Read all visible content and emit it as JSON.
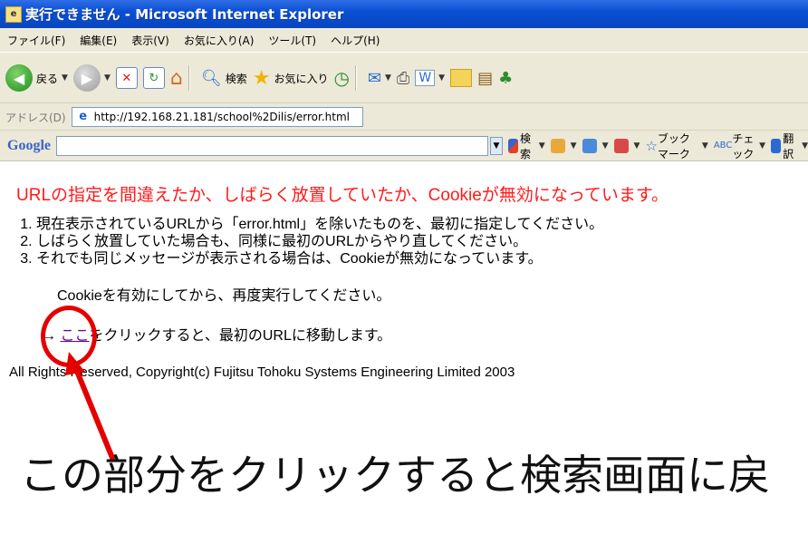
{
  "window": {
    "title": "実行できません - Microsoft Internet Explorer"
  },
  "menu": [
    "ファイル(F)",
    "編集(E)",
    "表示(V)",
    "お気に入り(A)",
    "ツール(T)",
    "ヘルプ(H)"
  ],
  "toolbar": {
    "back_label": "戻る",
    "search_label": "検索",
    "favorites_label": "お気に入り"
  },
  "address": {
    "label": "アドレス(D)",
    "url": "http://192.168.21.181/school%2Dilis/error.html"
  },
  "google": {
    "logo": "Google",
    "search_label": "検索",
    "bookmark_label": "ブックマーク",
    "check_label": "チェック",
    "translate_label": "翻訳"
  },
  "page": {
    "heading": "URLの指定を間違えたか、しばらく放置していたか、Cookieが無効になっています。",
    "items": [
      "現在表示されているURLから「error.html」を除いたものを、最初に指定してください。",
      "しばらく放置していた場合も、同様に最初のURLからやり直してください。",
      "それでも同じメッセージが表示される場合は、Cookieが無効になっています。"
    ],
    "cookie_line": "Cookieを有効にしてから、再度実行してください。",
    "arrow": "→",
    "link_text": "ここ",
    "link_suffix": "をクリックすると、最初のURLに移動します。",
    "copyright": "All Rights Reserved, Copyright(c) Fujitsu Tohoku Systems Engineering Limited 2003"
  },
  "annotation": {
    "text": "この部分をクリックすると検索画面に戻",
    "color": "#e50000"
  }
}
